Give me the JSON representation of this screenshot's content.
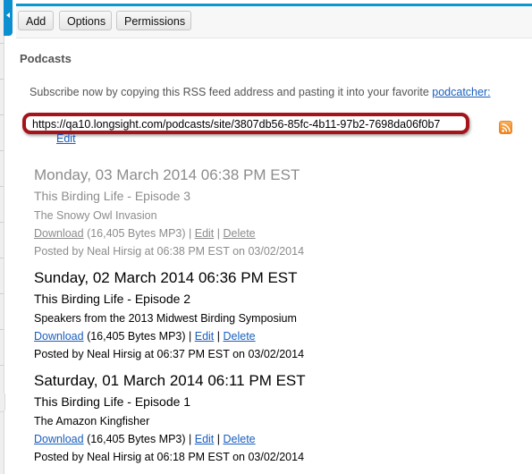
{
  "toolbar": {
    "buttons": [
      {
        "label": "Add"
      },
      {
        "label": "Options"
      },
      {
        "label": "Permissions"
      }
    ]
  },
  "page": {
    "title": "Podcasts",
    "subscribe_text": "Subscribe now by copying this RSS feed address and pasting it into your favorite ",
    "podcatcher_link": "podcatcher:",
    "feed_url": "https://qa10.longsight.com/podcasts/site/3807db56-85fc-4b11-97b2-7698da06f0b7",
    "feed_edit_label": "Edit",
    "rss_icon": "rss-feed-icon",
    "accent_color": "#0b96cf",
    "highlight_color": "#a4141a"
  },
  "podcasts": [
    {
      "date": "Monday, 03 March 2014 06:38 PM EST",
      "title": "This Birding Life - Episode 3",
      "description": "The Snowy Owl Invasion",
      "download_label": "Download",
      "file_info": " (16,405 Bytes MP3) | ",
      "edit_label": "Edit",
      "delete_label": "Delete",
      "posted": "Posted by Neal Hirsig at 06:38 PM EST on 03/02/2014",
      "hidden": true
    },
    {
      "date": "Sunday, 02 March 2014 06:36 PM EST",
      "title": "This Birding Life - Episode 2",
      "description": "Speakers from the 2013 Midwest Birding Symposium",
      "download_label": "Download",
      "file_info": " (16,405 Bytes MP3) | ",
      "edit_label": "Edit",
      "delete_label": "Delete",
      "posted": "Posted by Neal Hirsig at 06:37 PM EST on 03/02/2014",
      "hidden": false
    },
    {
      "date": "Saturday, 01 March 2014 06:11 PM EST",
      "title": "This Birding Life - Episode 1",
      "description": "The Amazon Kingfisher",
      "download_label": "Download",
      "file_info": " (16,405 Bytes MP3) | ",
      "edit_label": "Edit",
      "delete_label": "Delete",
      "posted": "Posted by Neal Hirsig at 06:18 PM EST on 03/02/2014",
      "hidden": false
    }
  ],
  "separator": " | "
}
